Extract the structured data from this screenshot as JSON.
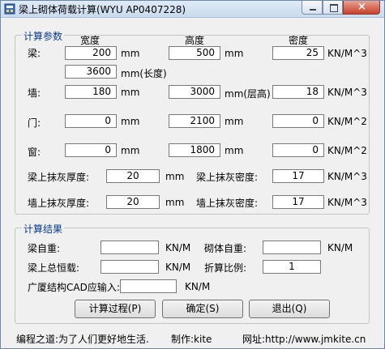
{
  "window": {
    "title": "梁上砌体荷载计算(WYU AP0407228)"
  },
  "params": {
    "legend": "计算参数",
    "headers": {
      "width": "宽度",
      "height": "高度",
      "density": "密度"
    },
    "beam": {
      "label": "梁:",
      "width": "200",
      "width_unit": "mm",
      "height": "500",
      "height_unit": "mm",
      "density": "25",
      "density_unit": "KN/M^3",
      "length": "3600",
      "length_unit": "mm(长度)"
    },
    "wall": {
      "label": "墙:",
      "width": "180",
      "width_unit": "mm",
      "height": "3000",
      "height_unit": "mm(层高)",
      "density": "18",
      "density_unit": "KN/M^3"
    },
    "door": {
      "label": "门:",
      "width": "0",
      "width_unit": "mm",
      "height": "2100",
      "height_unit": "mm",
      "density": "0",
      "density_unit": "KN/M^2"
    },
    "window": {
      "label": "窗:",
      "width": "0",
      "width_unit": "mm",
      "height": "1800",
      "height_unit": "mm",
      "density": "0",
      "density_unit": "KN/M^2"
    },
    "beam_plaster": {
      "label": "梁上抹灰厚度:",
      "thickness": "20",
      "thickness_unit": "mm",
      "density_label": "梁上抹灰密度:",
      "density": "17",
      "density_unit": "KN/M^3"
    },
    "wall_plaster": {
      "label": "墙上抹灰厚度:",
      "thickness": "20",
      "thickness_unit": "mm",
      "density_label": "墙上抹灰密度:",
      "density": "17",
      "density_unit": "KN/M^3"
    }
  },
  "results": {
    "legend": "计算结果",
    "beam_weight": {
      "label": "梁自重:",
      "value": "",
      "unit": "KN/M"
    },
    "masonry_weight": {
      "label": "砌体自重:",
      "value": "",
      "unit": "KN/M"
    },
    "beam_total": {
      "label": "梁上总恒载:",
      "value": "",
      "unit": "KN/M"
    },
    "reduction": {
      "label": "折算比例:",
      "value": "1"
    },
    "cad_input": {
      "label": "广厦结构CAD应输入:",
      "value": "",
      "unit": "KN/M"
    }
  },
  "buttons": {
    "process": "计算过程(P)",
    "ok": "确定(S)",
    "exit": "退出(Q)"
  },
  "footer": {
    "motto": "编程之道:为了人们更好地生活.",
    "author": "制作:kite",
    "site": "网址:http://www.jmkite.cn"
  }
}
